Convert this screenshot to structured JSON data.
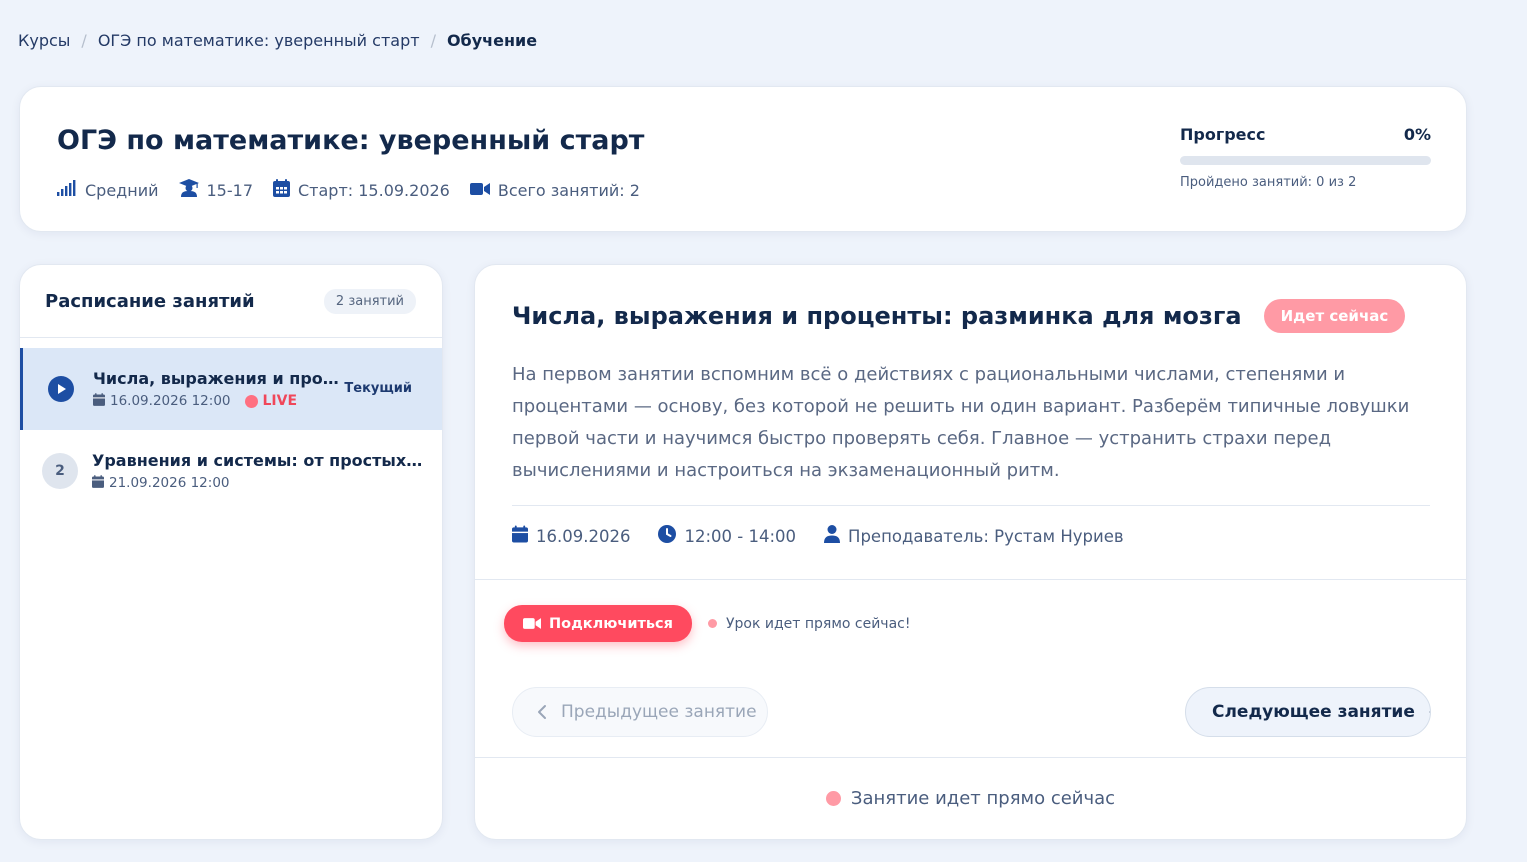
{
  "breadcrumb": {
    "items": [
      "Курсы",
      "ОГЭ по математике: уверенный старт"
    ],
    "current": "Обучение",
    "separator": "/"
  },
  "course": {
    "title": "ОГЭ по математике: уверенный старт",
    "level": "Средний",
    "age": "15-17",
    "start": "Старт: 15.09.2026",
    "total_lessons": "Всего занятий: 2"
  },
  "progress": {
    "label": "Прогресс",
    "percent_label": "0%",
    "percent": 0,
    "completed": "Пройдено занятий: 0 из 2"
  },
  "schedule": {
    "title": "Расписание занятий",
    "count_badge": "2 занятий",
    "lessons": [
      {
        "number": "",
        "title": "Числа, выражения и проц...",
        "datetime": "16.09.2026 12:00",
        "live_label": "LIVE",
        "status": "Текущий",
        "active": true
      },
      {
        "number": "2",
        "title": "Уравнения и системы: от простых к те...",
        "datetime": "21.09.2026 12:00",
        "active": false
      }
    ]
  },
  "lesson_detail": {
    "title": "Числа, выражения и проценты: разминка для мозга",
    "status_pill": "Идет сейчас",
    "description": "На первом занятии вспомним всё о действиях с рациональными числами, степенями и процентами — основу, без которой не решить ни один вариант. Разберём типичные ловушки первой части и научимся быстро проверять себя. Главное — устранить страхи перед вычислениями и настроиться на экзаменационный ритм.",
    "date": "16.09.2026",
    "time": "12:00 - 14:00",
    "teacher": "Преподаватель: Рустам Нуриев",
    "join_button": "Подключиться",
    "join_note": "Урок идет прямо сейчас!",
    "prev_button": "Предыдущее занятие",
    "next_button": "Следующее занятие",
    "footer_status": "Занятие идет прямо сейчас"
  },
  "colors": {
    "accent": "#1d4ea3",
    "live": "#ff4a5f",
    "live_soft": "#ff9aa5",
    "background": "#eef3fb"
  },
  "icons": [
    "signal-bars-icon",
    "graduate-icon",
    "calendar-icon",
    "video-camera-icon",
    "play-icon",
    "clock-icon",
    "user-icon",
    "chevron-left-icon",
    "chevron-right-icon"
  ]
}
